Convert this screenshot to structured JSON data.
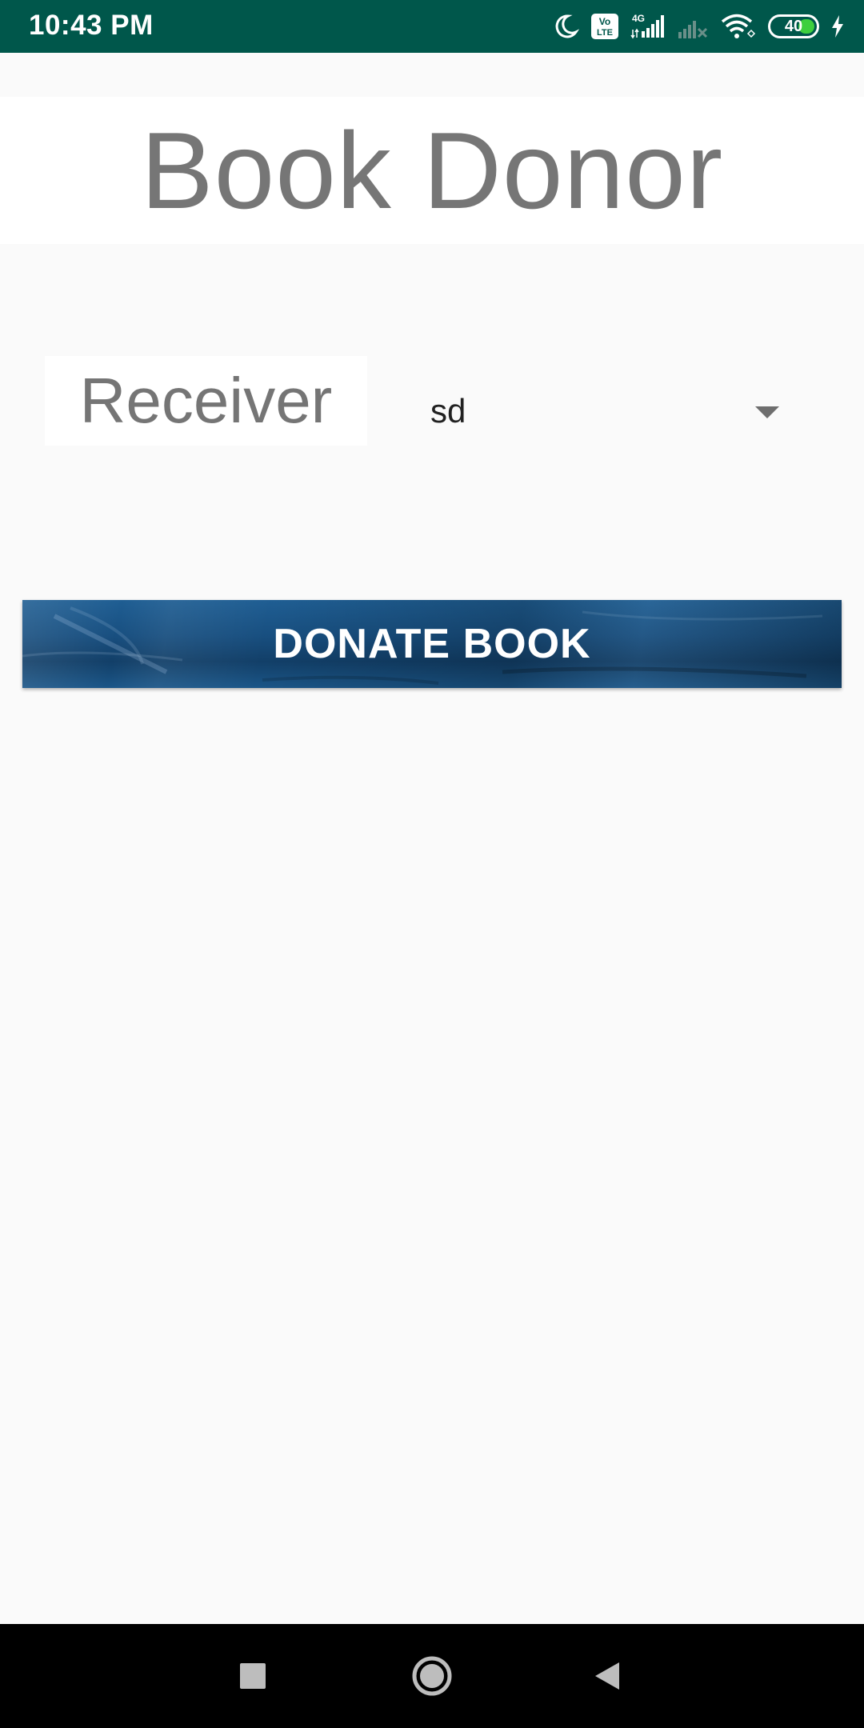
{
  "status_bar": {
    "time": "10:43 PM",
    "battery_level": "40",
    "icons": [
      "moon-icon",
      "volte-icon",
      "signal-4g-icon",
      "signal-no-service-icon",
      "wifi-icon",
      "battery-icon",
      "charging-icon"
    ],
    "volte_label": "Vo LTE",
    "network_label": "4G"
  },
  "header": {
    "title": "Book Donor"
  },
  "form": {
    "receiver_label": "Receiver",
    "receiver_selected": "sd"
  },
  "actions": {
    "donate_label": "DONATE BOOK"
  },
  "colors": {
    "status_bar": "#00574b",
    "title_text": "#767676",
    "button_blue": "#184f80",
    "battery_fill": "#3ecf3e"
  },
  "nav_bar": {
    "buttons": [
      "recents-icon",
      "home-icon",
      "back-icon"
    ]
  }
}
